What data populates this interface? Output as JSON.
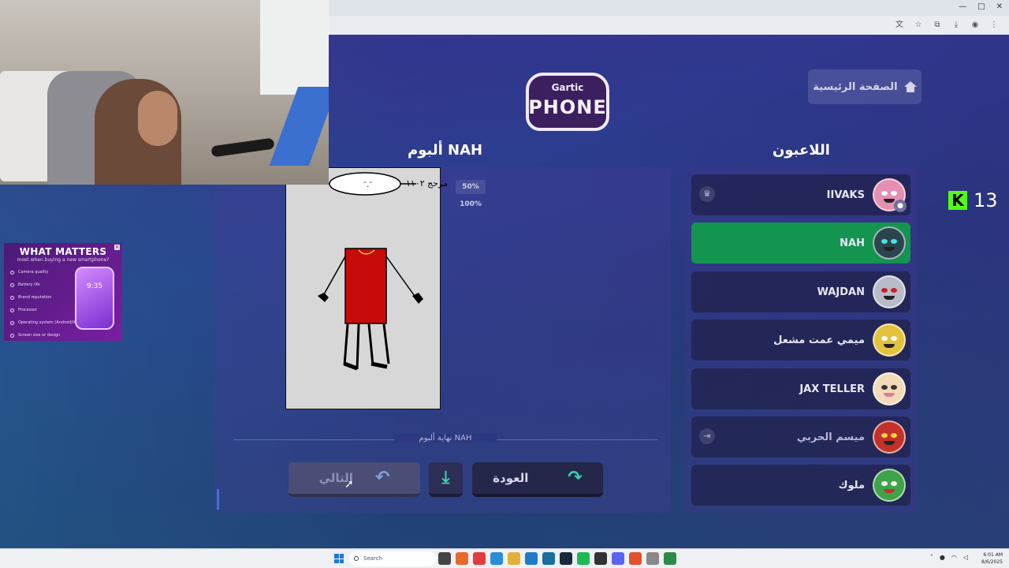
{
  "browser": {
    "icons": [
      "translate-icon",
      "star-icon",
      "extensions-icon",
      "download-icon",
      "profile-icon",
      "menu-icon"
    ],
    "window_controls": [
      "—",
      "□",
      "✕"
    ]
  },
  "ad": {
    "title": "WHAT MATTERS",
    "subtitle": "most when buying a new smartphone?",
    "items": [
      "Camera quality",
      "Battery life",
      "Brand reputation",
      "Processor",
      "Operating system (Android/iOS)",
      "Screen size or design"
    ],
    "phone_time": "9:35"
  },
  "logo": {
    "small": "Gartic",
    "big": "PHONE"
  },
  "nav": {
    "home_label": "الصفحة الرئيسية"
  },
  "album": {
    "title": "ألبوم NAH",
    "zoom_options": [
      "50%",
      "100%"
    ],
    "end_label": "نهاية ألبوم NAH",
    "next_label": "التالي",
    "back_label": "العودة",
    "drawing_text": "مرحج ١١٠٢"
  },
  "players": {
    "title": "اللاعبون",
    "list": [
      {
        "name": "IIVAKS",
        "avatar_color": "#e58fb2",
        "side_icon": "crown-icon",
        "active": false
      },
      {
        "name": "NAH",
        "avatar_color": "#2b4550",
        "active": true
      },
      {
        "name": "WAJDAN",
        "avatar_color": "#b9bcc8",
        "active": false
      },
      {
        "name": "ميمي عمت مشعل",
        "avatar_color": "#e4c23d",
        "active": false
      },
      {
        "name": "JAX TELLER",
        "avatar_color": "#f2d9b8",
        "active": false
      },
      {
        "name": "ميسم الحربي",
        "avatar_color": "#c2322a",
        "side_icon": "kick-player-icon",
        "active": false
      },
      {
        "name": "ملوك",
        "avatar_color": "#3fa34a",
        "active": false
      }
    ]
  },
  "kick": {
    "count": "13"
  },
  "taskbar": {
    "search_placeholder": "Search",
    "clock_time": "6:01 AM",
    "clock_date": "8/6/2025"
  }
}
